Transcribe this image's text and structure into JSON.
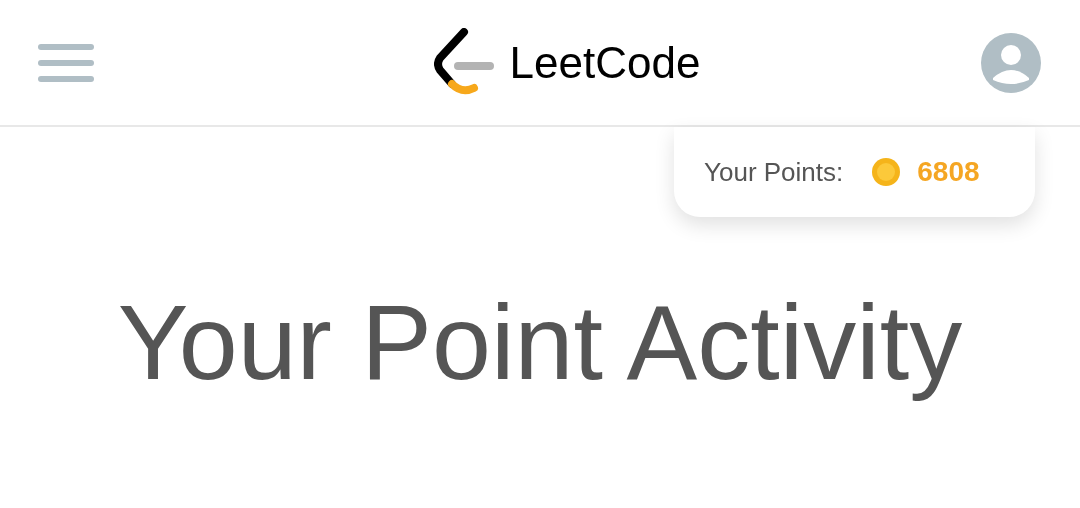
{
  "header": {
    "logo_text": "LeetCode"
  },
  "points_card": {
    "label": "Your Points:",
    "value": "6808"
  },
  "title": "Your Point Activity"
}
